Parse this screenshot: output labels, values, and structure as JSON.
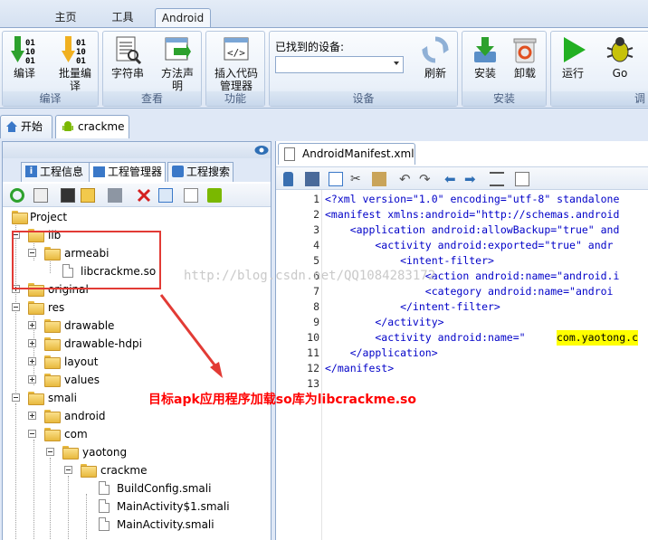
{
  "menu": {
    "tabs": [
      {
        "label": "主页"
      },
      {
        "label": "工具"
      },
      {
        "label": "Android"
      }
    ]
  },
  "ribbon": {
    "groups": [
      {
        "name": "编译",
        "buttons": [
          "编译",
          "批量编\n译"
        ]
      },
      {
        "name": "查看",
        "buttons": [
          "字符串",
          "方法声\n明"
        ]
      },
      {
        "name": "功能",
        "buttons": [
          "插入代码\n管理器"
        ]
      },
      {
        "name": "设备",
        "device_label": "已找到的设备:",
        "device_value": "",
        "buttons": [
          "刷新"
        ]
      },
      {
        "name": "安装",
        "buttons": [
          "安装",
          "卸载"
        ]
      },
      {
        "name": "调",
        "buttons": [
          "运行",
          "Go"
        ]
      }
    ]
  },
  "doc_tabs": [
    {
      "label": "开始"
    },
    {
      "label": "crackme"
    }
  ],
  "left_panel": {
    "subtabs": [
      {
        "label": "工程信息"
      },
      {
        "label": "工程管理器"
      },
      {
        "label": "工程搜索"
      }
    ],
    "tree": [
      {
        "label": "Project"
      },
      {
        "label": "lib"
      },
      {
        "label": "armeabi"
      },
      {
        "label": "libcrackme.so"
      },
      {
        "label": "original"
      },
      {
        "label": "res"
      },
      {
        "label": "drawable"
      },
      {
        "label": "drawable-hdpi"
      },
      {
        "label": "layout"
      },
      {
        "label": "values"
      },
      {
        "label": "smali"
      },
      {
        "label": "android"
      },
      {
        "label": "com"
      },
      {
        "label": "yaotong"
      },
      {
        "label": "crackme"
      },
      {
        "label": "BuildConfig.smali"
      },
      {
        "label": "MainActivity$1.smali"
      },
      {
        "label": "MainActivity.smali"
      }
    ]
  },
  "editor": {
    "tab_label": "AndroidManifest.xml",
    "line_numbers": [
      "1",
      "2",
      "3",
      "4",
      "5",
      "6",
      "7",
      "8",
      "9",
      "10",
      "11",
      "12",
      "13"
    ],
    "lines": [
      "<?xml version=\"1.0\" encoding=\"utf-8\" standalone",
      "<manifest xmlns:android=\"http://schemas.android",
      "    <application android:allowBackup=\"true\" and",
      "        <activity android:exported=\"true\" andr",
      "            <intent-filter>",
      "                <action android:name=\"android.i",
      "                <category android:name=\"androi",
      "            </intent-filter>",
      "        </activity>",
      "        <activity android:name=\"",
      "    </application>",
      "</manifest>",
      ""
    ],
    "highlight_text": "com.yaotong.c"
  },
  "annotation": {
    "caption": "目标apk应用程序加载so库为libcrackme.so",
    "watermark": "http://blog.csdn.net/QQ1084283172"
  },
  "colors": {
    "annotation_red": "#e23b35",
    "caption_red": "#ff0000",
    "xml_tag_blue": "#0000c8",
    "highlight_yellow": "#ffff00"
  }
}
